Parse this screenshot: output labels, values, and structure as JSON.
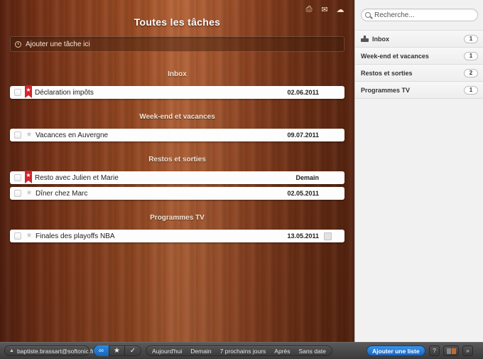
{
  "main": {
    "title": "Toutes les tâches",
    "add_task_placeholder": "Ajouter une tâche ici",
    "top_icons": [
      "print-icon",
      "mail-icon",
      "cloud-icon"
    ],
    "sections": [
      {
        "title": "Inbox",
        "tasks": [
          {
            "title": "Déclaration impôts",
            "date": "02.06.2011",
            "starred": true,
            "note": false
          }
        ]
      },
      {
        "title": "Week-end et vacances",
        "tasks": [
          {
            "title": "Vacances en Auvergne",
            "date": "09.07.2011",
            "starred": false,
            "note": false
          }
        ]
      },
      {
        "title": "Restos et sorties",
        "tasks": [
          {
            "title": "Resto avec Julien et Marie",
            "date": "Demain",
            "starred": true,
            "note": false
          },
          {
            "title": "Dîner chez Marc",
            "date": "02.05.2011",
            "starred": false,
            "note": false
          }
        ]
      },
      {
        "title": "Programmes TV",
        "tasks": [
          {
            "title": "Finales des playoffs NBA",
            "date": "13.05.2011",
            "starred": false,
            "note": true
          }
        ]
      }
    ]
  },
  "sidebar": {
    "search_placeholder": "Recherche...",
    "lists": [
      {
        "name": "Inbox",
        "count": "1",
        "icon": "inbox-icon"
      },
      {
        "name": "Week-end et vacances",
        "count": "1"
      },
      {
        "name": "Restos et sorties",
        "count": "2"
      },
      {
        "name": "Programmes TV",
        "count": "1"
      }
    ]
  },
  "bottombar": {
    "user": "baptiste.brassart@softonic.fr",
    "filters": [
      "infinity-icon",
      "star-icon",
      "check-icon"
    ],
    "date_filters": [
      "Aujourd'hui",
      "Demain",
      "7 prochains jours",
      "Après",
      "Sans date"
    ],
    "add_list_label": "Ajouter une liste",
    "help_label": "?",
    "more_label": "»"
  },
  "colors": {
    "accent_blue": "#2579d6",
    "flag_red": "#d3242c",
    "wood": "#9a4c24"
  }
}
